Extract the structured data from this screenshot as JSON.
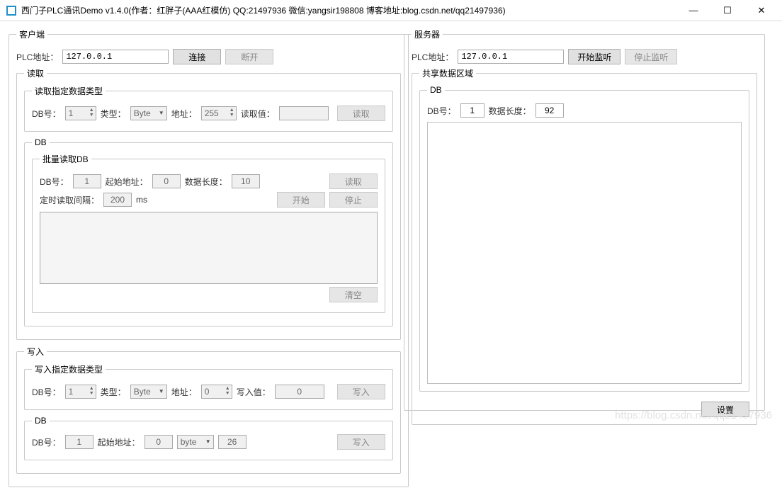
{
  "window": {
    "title": "西门子PLC通讯Demo v1.4.0(作者：红胖子(AAA红模仿) QQ:21497936 微信:yangsir198808 博客地址:blog.csdn.net/qq21497936)",
    "min": "—",
    "max": "☐",
    "close": "✕"
  },
  "client": {
    "legend": "客户端",
    "plc_addr_label": "PLC地址：",
    "plc_addr_value": "127.0.0.1",
    "connect": "连接",
    "disconnect": "断开",
    "read": {
      "legend": "读取",
      "typed": {
        "legend": "读取指定数据类型",
        "db_label": "DB号：",
        "db_value": "1",
        "type_label": "类型：",
        "type_value": "Byte",
        "addr_label": "地址：",
        "addr_value": "255",
        "val_label": "读取值：",
        "val_value": "",
        "read_btn": "读取"
      },
      "db": {
        "legend": "DB",
        "batch_legend": "批量读取DB",
        "db_label": "DB号：",
        "db_value": "1",
        "start_label": "起始地址：",
        "start_value": "0",
        "len_label": "数据长度：",
        "len_value": "10",
        "read_btn": "读取",
        "interval_label": "定时读取间隔：",
        "interval_value": "200",
        "interval_unit": "ms",
        "start_btn": "开始",
        "stop_btn": "停止",
        "clear_btn": "清空"
      }
    },
    "write": {
      "legend": "写入",
      "typed": {
        "legend": "写入指定数据类型",
        "db_label": "DB号：",
        "db_value": "1",
        "type_label": "类型：",
        "type_value": "Byte",
        "addr_label": "地址：",
        "addr_value": "0",
        "val_label": "写入值：",
        "val_value": "0",
        "write_btn": "写入"
      },
      "db": {
        "legend": "DB",
        "db_label": "DB号：",
        "db_value": "1",
        "start_label": "起始地址：",
        "start_value": "0",
        "type_value": "byte",
        "extra_value": "26",
        "write_btn": "写入"
      }
    }
  },
  "server": {
    "legend": "服务器",
    "plc_addr_label": "PLC地址：",
    "plc_addr_value": "127.0.0.1",
    "start_listen": "开始监听",
    "stop_listen": "停止监听",
    "shared": {
      "legend": "共享数据区域",
      "db_legend": "DB",
      "db_label": "DB号：",
      "db_value": "1",
      "len_label": "数据长度：",
      "len_value": "92",
      "set_btn": "设置"
    }
  },
  "watermark": "https://blog.csdn.net/qq21497936"
}
